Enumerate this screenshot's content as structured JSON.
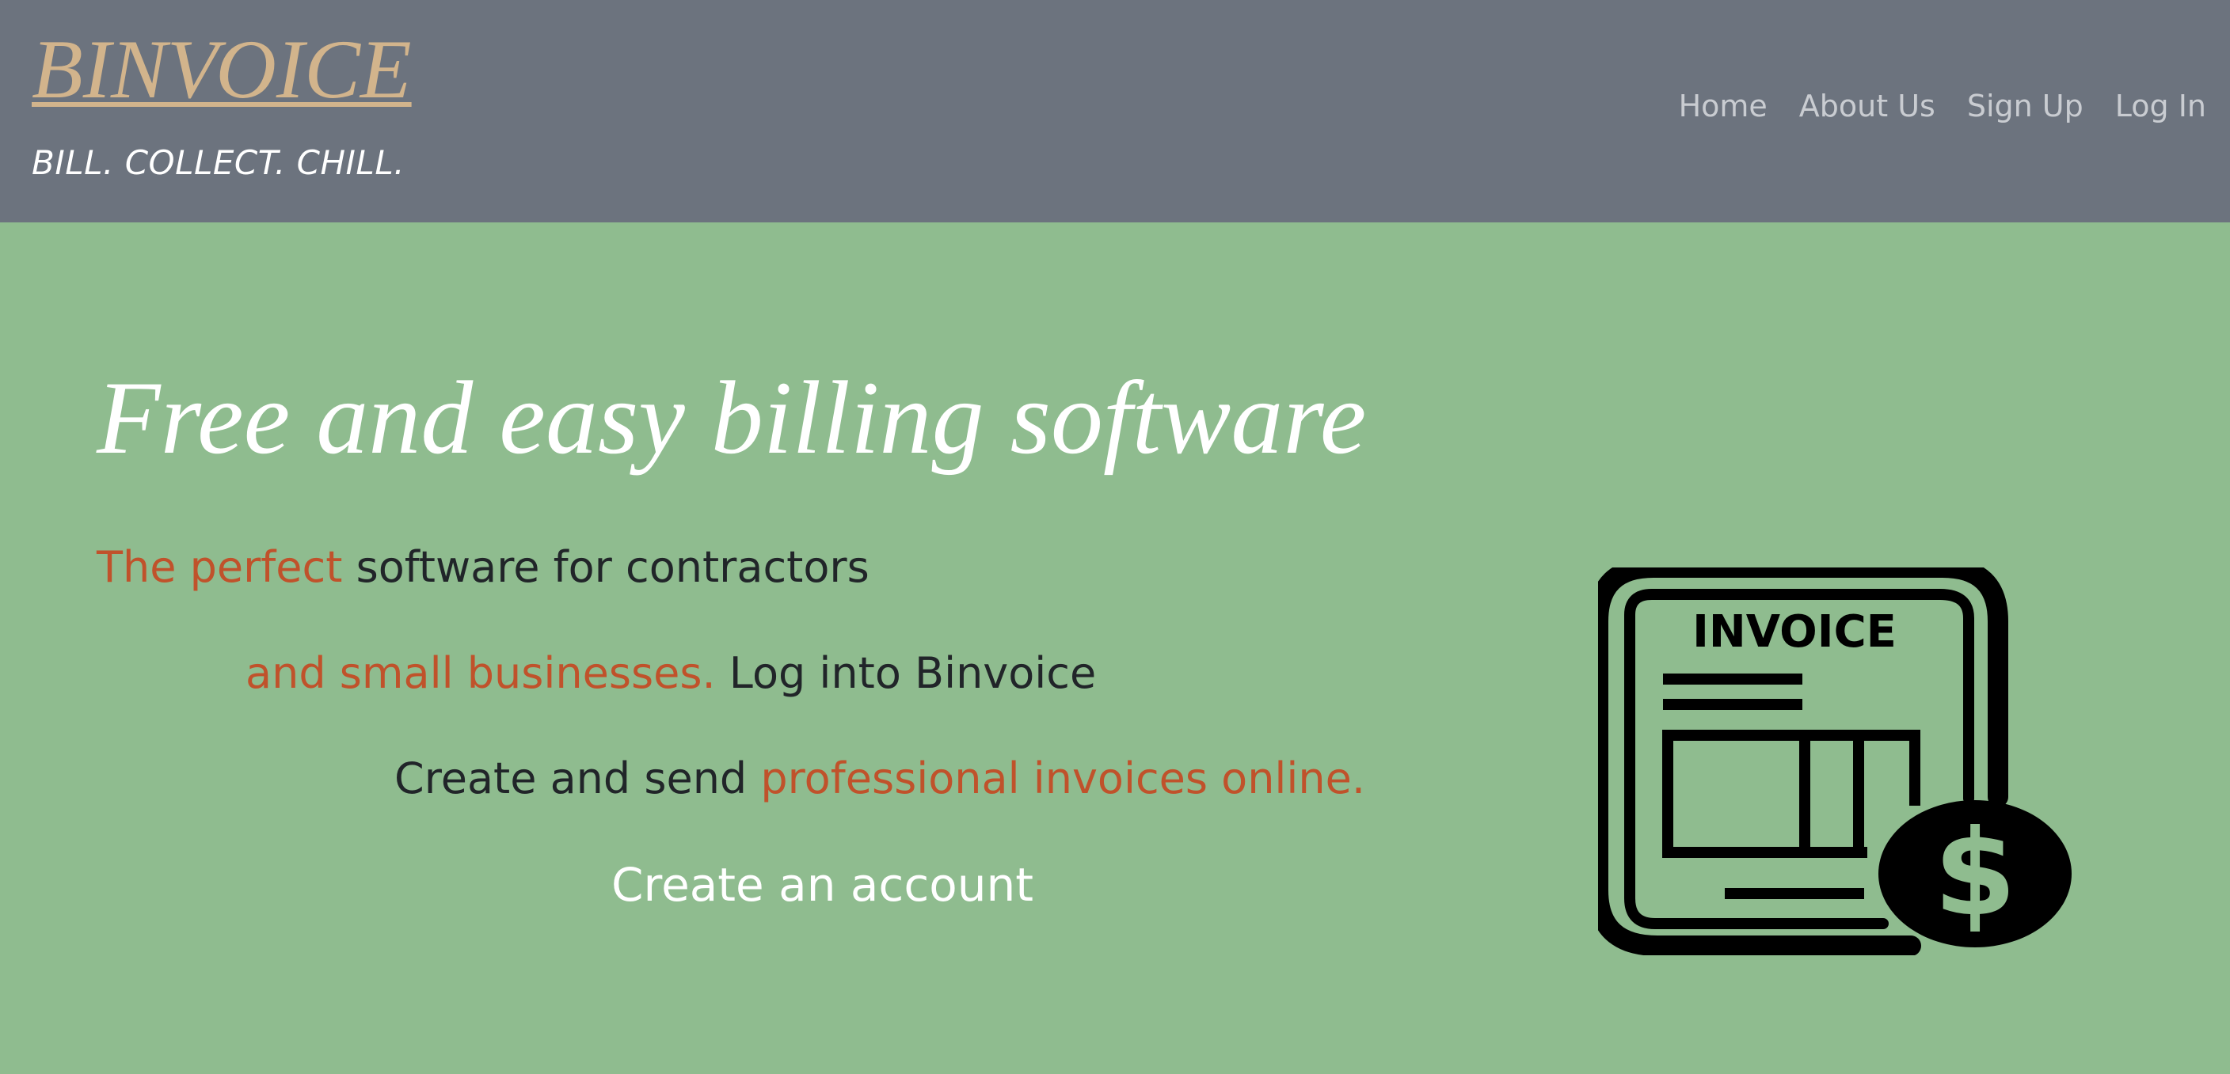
{
  "header": {
    "brand": "BINVOICE",
    "tagline": "BILL. COLLECT. CHILL.",
    "nav": [
      {
        "label": "Home"
      },
      {
        "label": "About Us"
      },
      {
        "label": "Sign Up"
      },
      {
        "label": "Log In"
      }
    ]
  },
  "hero": {
    "title": "Free and easy billing software",
    "line1": {
      "accent": "The perfect",
      "text": " software for contractors"
    },
    "line2": {
      "accent": "and small businesses.",
      "text": " Log into Binvoice"
    },
    "line3": {
      "text": "Create and send ",
      "accent": "professional invoices online."
    },
    "cta": "Create an account",
    "graphic": {
      "label": "INVOICE",
      "icon": "invoice-dollar-icon",
      "currency_symbol": "$"
    }
  },
  "colors": {
    "header_bg": "#6c737e",
    "hero_bg": "#8fbc8f",
    "brand": "#d2b48c",
    "accent": "#c0522b",
    "nav_text": "#c9ccd1",
    "body_text": "#212529"
  }
}
